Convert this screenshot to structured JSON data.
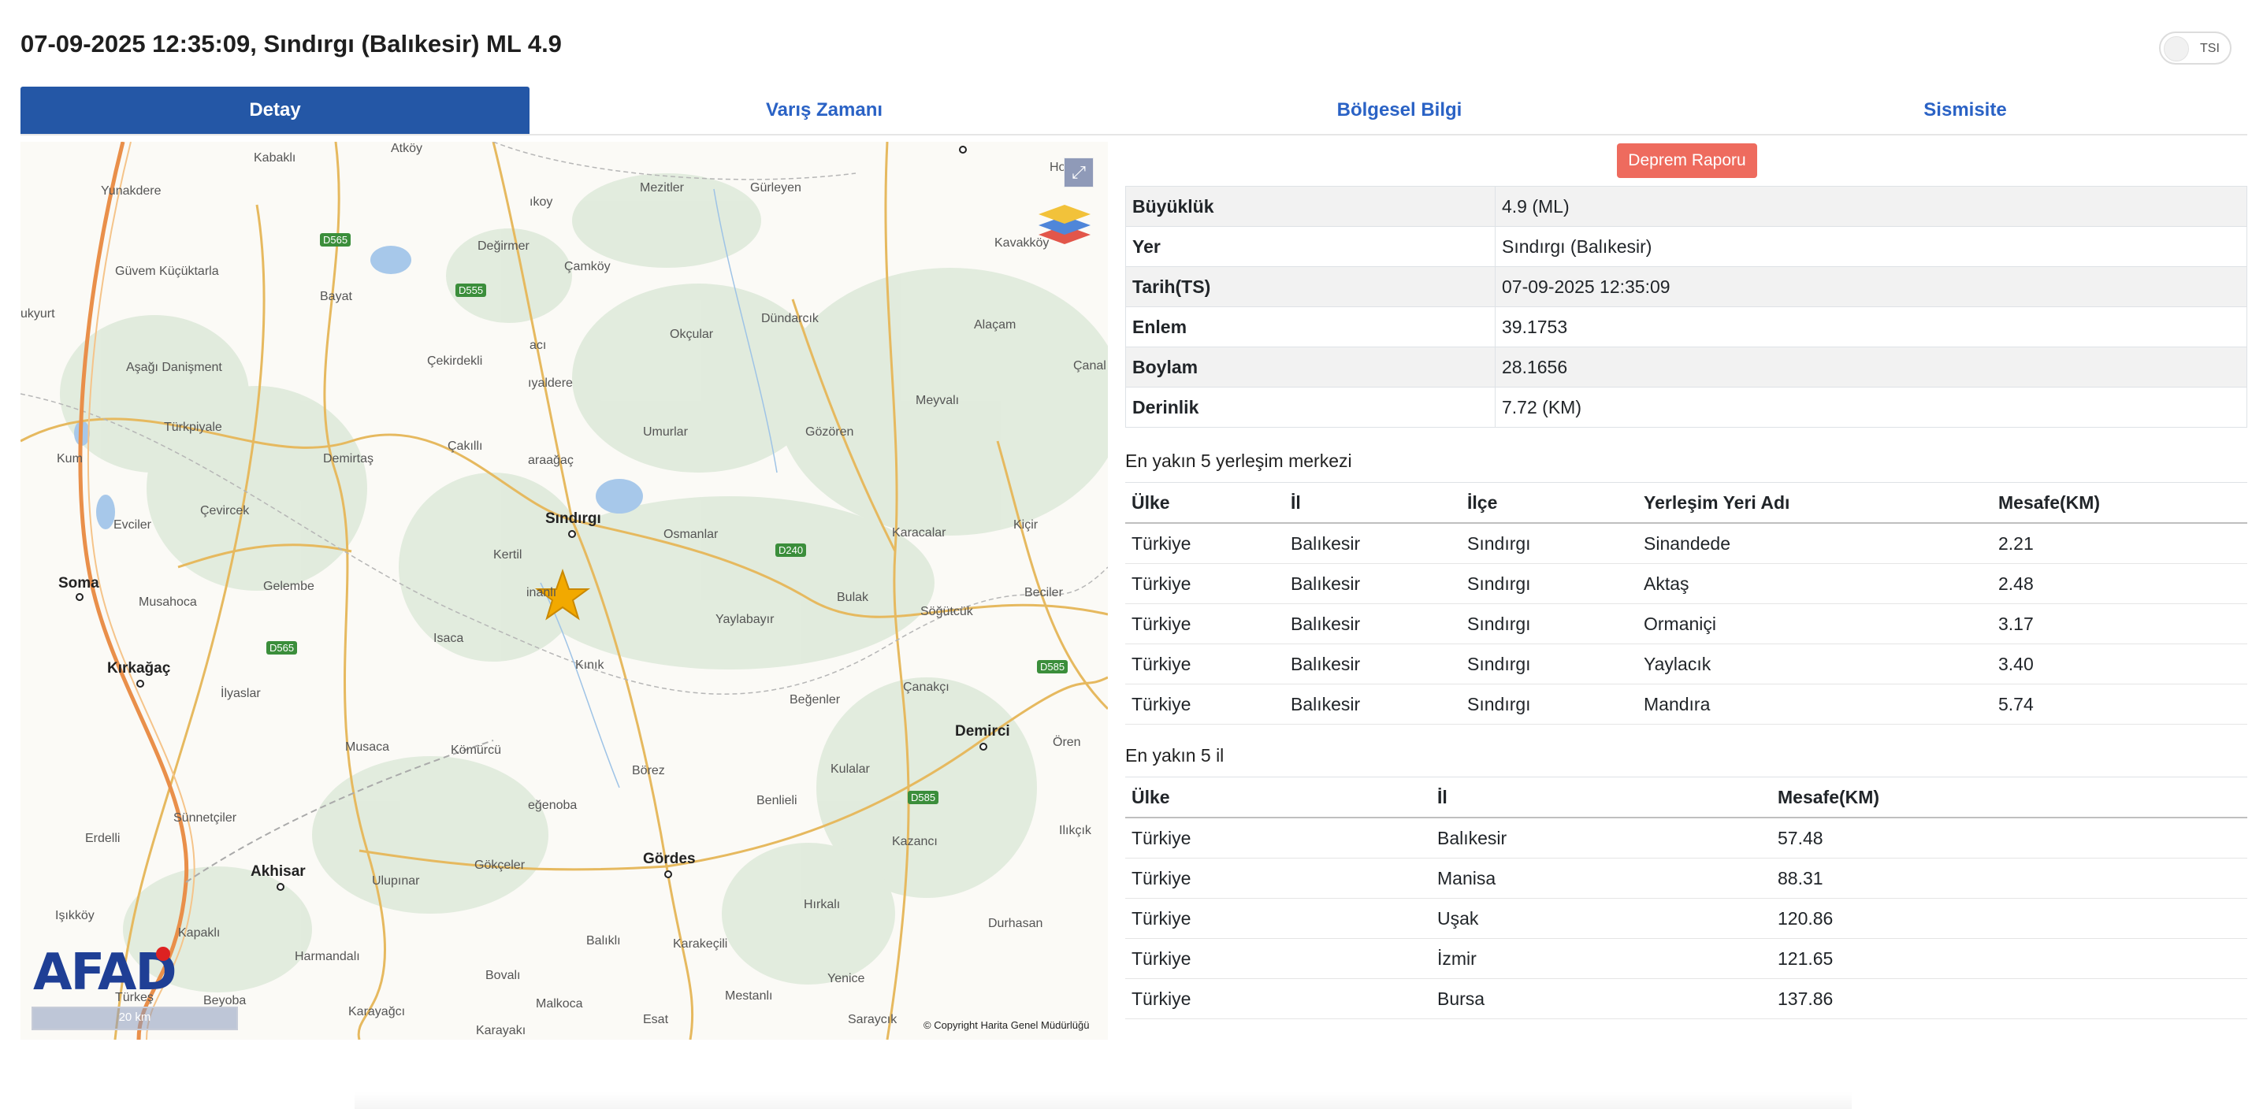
{
  "header": {
    "title": "07-09-2025 12:35:09, Sındırgı (Balıkesir) ML 4.9",
    "toggle_label": "TSI"
  },
  "tabs": [
    {
      "label": "Detay",
      "active": true
    },
    {
      "label": "Varış Zamanı",
      "active": false
    },
    {
      "label": "Bölgesel Bilgi",
      "active": false
    },
    {
      "label": "Sismisite",
      "active": false
    }
  ],
  "map": {
    "places": [
      "Atköy",
      "Kabaklı",
      "Yunakdere",
      "Mezitler",
      "Gürleyen",
      "Hocalar",
      "Değirmer",
      "Çamköy",
      "Kavakköy",
      "Güvem Küçüktarla",
      "Bayat",
      "ıkoy",
      "Dündarcık",
      "Alaçam",
      "ukyurt",
      "Aşağı Danişment",
      "Çekirdekli",
      "acı",
      "Okçular",
      "Çanal",
      "ıyaldere",
      "Türkpiyale",
      "Meyvalı",
      "Gözören",
      "Umurlar",
      "Kum",
      "Demirtaş",
      "Çakıllı",
      "araağaç",
      "Çevircek",
      "Evciler",
      "Osmanlar",
      "Karacalar",
      "Kiçir",
      "Kertil",
      "Musahoca",
      "Gelembe",
      "inanlı",
      "Bulak",
      "Beciler",
      "Söğütcük",
      "Isaca",
      "Yaylabayır",
      "Kınık",
      "İlyaslar",
      "Beğenler",
      "Çanakçı",
      "Musaca",
      "Kömürcü",
      "Börez",
      "Kulalar",
      "Ören",
      "Erdelli",
      "Sünnetçiler",
      "eğenoba",
      "Benlieli",
      "Kazancı",
      "Ilıkçık",
      "Gökçeler",
      "Ulupınar",
      "Işıkköy",
      "Kapaklı",
      "Hırkalı",
      "Harmandalı",
      "Karakeçili",
      "Durhasan",
      "Balıklı",
      "Bovalı",
      "Mestanlı",
      "Beyoba",
      "Malkoca",
      "Karayağcı",
      "Esat",
      "Saraycık",
      "Karayakı",
      "Yenice",
      "Türkeş"
    ],
    "cities": [
      "Sındırgı",
      "Soma",
      "Kırkağaç",
      "Demirci",
      "Akhisar",
      "Gördes"
    ],
    "roads": [
      "D565",
      "D555",
      "D240",
      "D565",
      "D585",
      "D585"
    ],
    "logo": "AFAD",
    "scale_label": "20 km",
    "copyright": "© Copyright Harita Genel Müdürlüğü",
    "epicenter_color": "#f2a900"
  },
  "report_button": "Deprem Raporu",
  "details": [
    {
      "key": "Büyüklük",
      "value": "4.9 (ML)"
    },
    {
      "key": "Yer",
      "value": "Sındırgı (Balıkesir)"
    },
    {
      "key": "Tarih(TS)",
      "value": "07-09-2025 12:35:09"
    },
    {
      "key": "Enlem",
      "value": "39.1753"
    },
    {
      "key": "Boylam",
      "value": "28.1656"
    },
    {
      "key": "Derinlik",
      "value": "7.72 (KM)"
    }
  ],
  "settlements": {
    "heading": "En yakın 5 yerleşim merkezi",
    "columns": [
      "Ülke",
      "İl",
      "İlçe",
      "Yerleşim Yeri Adı",
      "Mesafe(KM)"
    ],
    "rows": [
      [
        "Türkiye",
        "Balıkesir",
        "Sındırgı",
        "Sinandede",
        "2.21"
      ],
      [
        "Türkiye",
        "Balıkesir",
        "Sındırgı",
        "Aktaş",
        "2.48"
      ],
      [
        "Türkiye",
        "Balıkesir",
        "Sındırgı",
        "Ormaniçi",
        "3.17"
      ],
      [
        "Türkiye",
        "Balıkesir",
        "Sındırgı",
        "Yaylacık",
        "3.40"
      ],
      [
        "Türkiye",
        "Balıkesir",
        "Sındırgı",
        "Mandıra",
        "5.74"
      ]
    ]
  },
  "provinces": {
    "heading": "En yakın 5 il",
    "columns": [
      "Ülke",
      "İl",
      "Mesafe(KM)"
    ],
    "rows": [
      [
        "Türkiye",
        "Balıkesir",
        "57.48"
      ],
      [
        "Türkiye",
        "Manisa",
        "88.31"
      ],
      [
        "Türkiye",
        "Uşak",
        "120.86"
      ],
      [
        "Türkiye",
        "İzmir",
        "121.65"
      ],
      [
        "Türkiye",
        "Bursa",
        "137.86"
      ]
    ]
  }
}
